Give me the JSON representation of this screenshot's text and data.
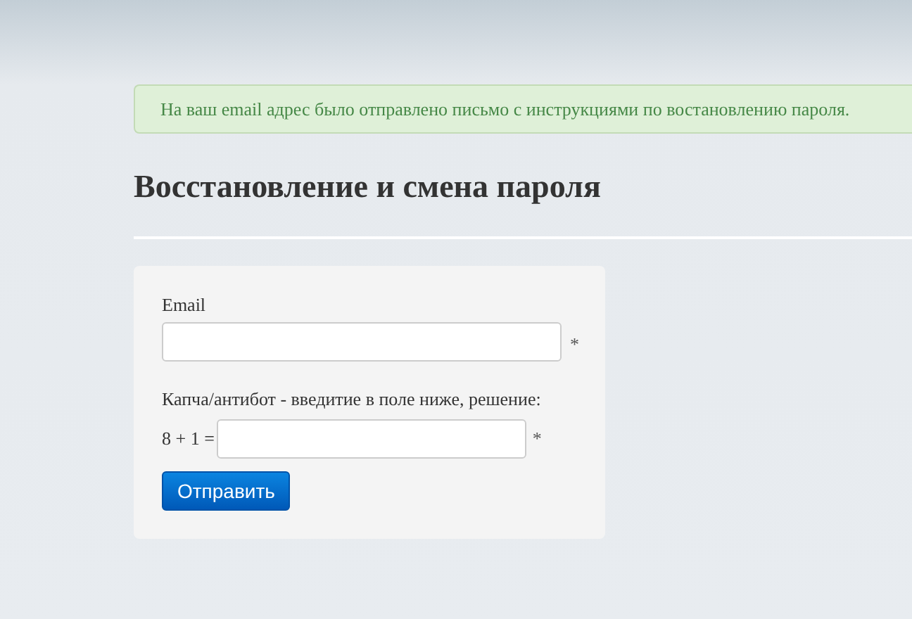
{
  "alert": {
    "text": "На ваш email адрес было отправлено письмо с инструкциями по востановлению пароля."
  },
  "heading": "Восстановление и смена пароля",
  "form": {
    "fields": [
      {
        "label": "Email",
        "required_mark": "*"
      }
    ],
    "captcha": {
      "label": "Капча/антибот - введитие в поле ниже, решение:",
      "question": "8 + 1 =",
      "required_mark": "*"
    },
    "submit": "Отправить"
  }
}
